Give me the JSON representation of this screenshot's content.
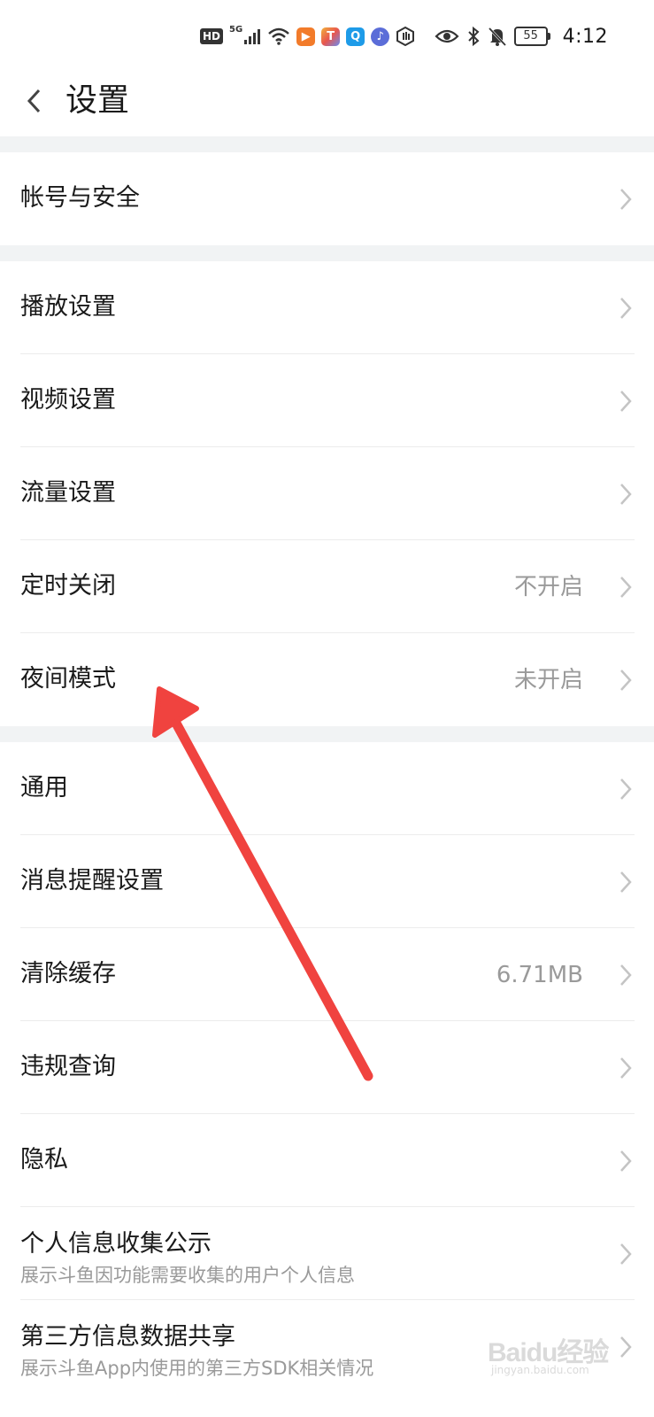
{
  "status_bar": {
    "hd": "HD",
    "network": "5G",
    "battery": "55",
    "time": "4:12",
    "apps": [
      {
        "icon": "play-app-icon",
        "color": "#f27b2a",
        "glyph": "▶"
      },
      {
        "icon": "t-app-icon",
        "color": "#e8564f",
        "glyph": "T"
      },
      {
        "icon": "search-app-icon",
        "color": "#1e9be8",
        "glyph": "Q"
      },
      {
        "icon": "music-app-icon",
        "color": "#5b6dd8",
        "glyph": "♪"
      }
    ]
  },
  "header": {
    "title": "设置",
    "back_icon": "chevron-left-icon"
  },
  "sections": [
    {
      "items": [
        {
          "label": "帐号与安全",
          "value": "",
          "sub": ""
        }
      ]
    },
    {
      "items": [
        {
          "label": "播放设置",
          "value": "",
          "sub": ""
        },
        {
          "label": "视频设置",
          "value": "",
          "sub": ""
        },
        {
          "label": "流量设置",
          "value": "",
          "sub": ""
        },
        {
          "label": "定时关闭",
          "value": "不开启",
          "sub": ""
        },
        {
          "label": "夜间模式",
          "value": "未开启",
          "sub": ""
        }
      ]
    },
    {
      "items": [
        {
          "label": "通用",
          "value": "",
          "sub": ""
        },
        {
          "label": "消息提醒设置",
          "value": "",
          "sub": ""
        },
        {
          "label": "清除缓存",
          "value": "6.71MB",
          "sub": ""
        },
        {
          "label": "违规查询",
          "value": "",
          "sub": ""
        },
        {
          "label": "隐私",
          "value": "",
          "sub": ""
        },
        {
          "label": "个人信息收集公示",
          "value": "",
          "sub": "展示斗鱼因功能需要收集的用户个人信息"
        },
        {
          "label": "第三方信息数据共享",
          "value": "",
          "sub": "展示斗鱼App内使用的第三方SDK相关情况"
        }
      ]
    }
  ],
  "annotation": {
    "color": "#f0433f",
    "icon": "red-arrow-annotation"
  },
  "watermark": {
    "text": "Baidu经验",
    "sub": "jingyan.baidu.com"
  },
  "colors": {
    "section_gap": "#f1f3f4",
    "secondary_text": "#9a9a9a",
    "chevron": "#c4c4c4"
  }
}
